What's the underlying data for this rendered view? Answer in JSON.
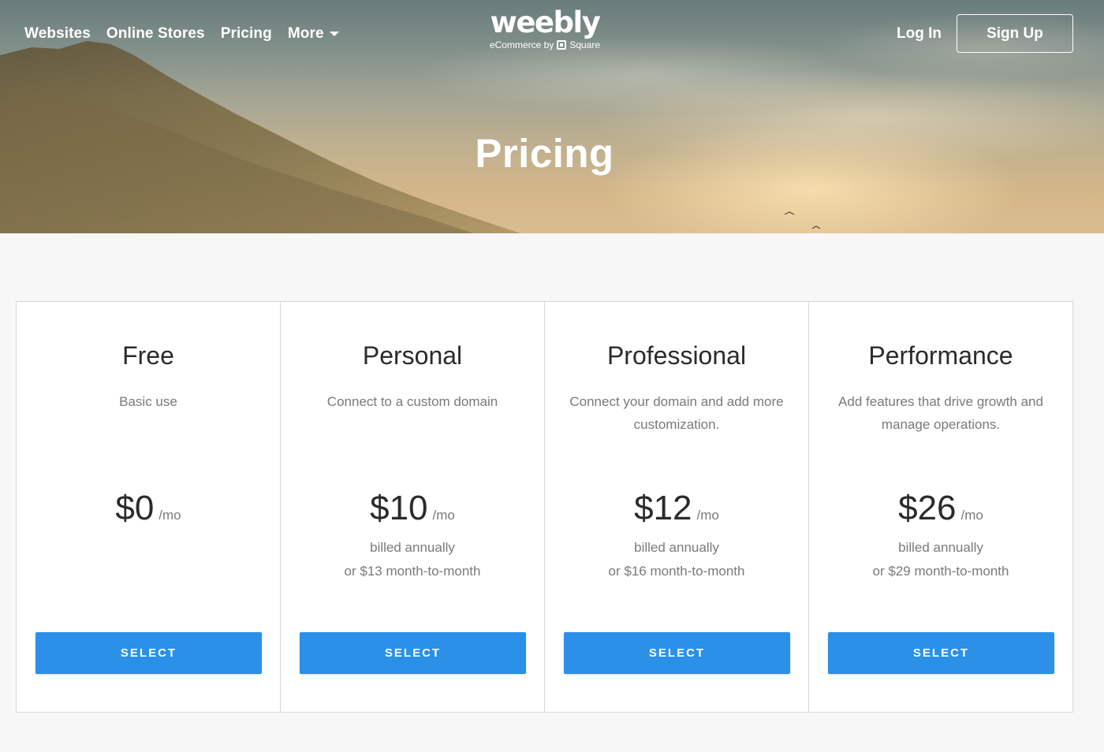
{
  "nav": {
    "items": [
      {
        "label": "Websites"
      },
      {
        "label": "Online Stores"
      },
      {
        "label": "Pricing"
      },
      {
        "label": "More"
      }
    ],
    "login_label": "Log In",
    "signup_label": "Sign Up"
  },
  "logo": {
    "wordmark": "weebly",
    "tagline_prefix": "eCommerce by",
    "tagline_brand": "Square"
  },
  "hero": {
    "title": "Pricing"
  },
  "plans": [
    {
      "name": "Free",
      "description": "Basic use",
      "price": "$0",
      "period": "/mo",
      "billing_line1": "",
      "billing_line2": "",
      "button_label": "SELECT"
    },
    {
      "name": "Personal",
      "description": "Connect to a custom domain",
      "price": "$10",
      "period": "/mo",
      "billing_line1": "billed annually",
      "billing_line2": "or $13 month-to-month",
      "button_label": "SELECT"
    },
    {
      "name": "Professional",
      "description": "Connect your domain and add more customization.",
      "price": "$12",
      "period": "/mo",
      "billing_line1": "billed annually",
      "billing_line2": "or $16 month-to-month",
      "button_label": "SELECT"
    },
    {
      "name": "Performance",
      "description": "Add features that drive growth and manage operations.",
      "price": "$26",
      "period": "/mo",
      "billing_line1": "billed annually",
      "billing_line2": "or $29 month-to-month",
      "button_label": "SELECT"
    }
  ],
  "colors": {
    "accent": "#2a90e8",
    "text_dark": "#2b2b2b",
    "text_muted": "#7a7a7a",
    "page_bg": "#f7f7f7"
  }
}
